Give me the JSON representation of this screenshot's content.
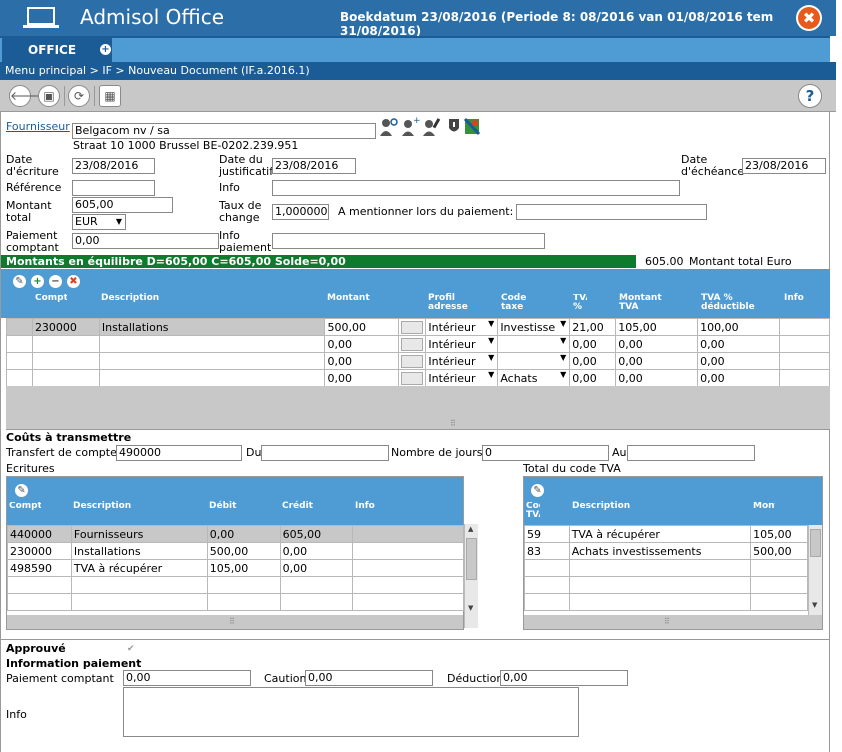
{
  "window": {
    "app_title": "Admisol Office",
    "book_date": "Boekdatum 23/08/2016 (Periode 8: 08/2016 van 01/08/2016 tem 31/08/2016)",
    "close_glyph": "✖"
  },
  "tabs": [
    {
      "label": "OFFICE"
    }
  ],
  "tab_add_glyph": "+",
  "breadcrumb": "Menu principal > IF > Nouveau Document (IF.a.2016.1)",
  "toolbar": {
    "help_glyph": "?",
    "back_glyph": "🡐",
    "save_glyph": "▣",
    "refresh_glyph": "⟳",
    "calendar_glyph": "▦"
  },
  "form": {
    "supplier_label": "Fournisseur",
    "supplier_value": "Belgacom nv / sa",
    "supplier_address": "Straat 10 1000 Brussel BE-0202.239.951",
    "entry_date_label": "Date d'écriture",
    "entry_date": "23/08/2016",
    "doc_date_label": "Date du justificatif",
    "doc_date": "23/08/2016",
    "due_date_label": "Date d'échéance",
    "due_date": "23/08/2016",
    "reference_label": "Référence",
    "reference": "",
    "info_label": "Info",
    "info": "",
    "total_label": "Montant total",
    "total": "605,00",
    "currency": "EUR",
    "rate_label": "Taux de change",
    "rate": "1,000000",
    "mention_label": "A mentionner lors du paiement:",
    "mention": "",
    "cash_label": "Paiement comptant",
    "cash": "0,00",
    "pay_info_label": "Info paiement",
    "pay_info": ""
  },
  "balance": {
    "text": "Montants en équilibre D=605,00 C=605,00 Solde=0,00",
    "total_euro_value": "605.00",
    "total_euro_label": "Montant total Euro"
  },
  "lines_grid": {
    "headers": [
      "Compte",
      "Description",
      "Montant",
      "Profil adresse",
      "Code taxe",
      "TVA %",
      "Montant TVA",
      "TVA % déductible",
      "Info"
    ],
    "rows": [
      [
        "230000",
        "Installations",
        "500,00",
        "",
        "Intérieur",
        "Investisse",
        "21,00",
        "105,00",
        "100,00",
        ""
      ],
      [
        "",
        "",
        "0,00",
        "",
        "Intérieur",
        "",
        "0,00",
        "0,00",
        "0,00",
        ""
      ],
      [
        "",
        "",
        "0,00",
        "",
        "Intérieur",
        "",
        "0,00",
        "0,00",
        "0,00",
        ""
      ],
      [
        "",
        "",
        "0,00",
        "",
        "Intérieur",
        "Achats",
        "0,00",
        "0,00",
        "0,00",
        ""
      ]
    ]
  },
  "transfer": {
    "title": "Coûts à transmettre",
    "account_label": "Transfert de compte",
    "account": "490000",
    "from_label": "Du",
    "from": "",
    "days_label": "Nombre de jours",
    "days": "0",
    "to_label": "Au",
    "to": ""
  },
  "entries": {
    "title": "Ecritures",
    "headers": [
      "Compte",
      "Description",
      "Débit",
      "Crédit",
      "Info"
    ],
    "rows": [
      [
        "440000",
        "Fournisseurs",
        "0,00",
        "605,00",
        ""
      ],
      [
        "230000",
        "Installations",
        "500,00",
        "0,00",
        ""
      ],
      [
        "498590",
        "TVA à récupérer",
        "105,00",
        "0,00",
        ""
      ]
    ]
  },
  "vat_totals": {
    "title": "Total du code TVA",
    "headers": [
      "Code TVA",
      "Description",
      "Montant"
    ],
    "rows": [
      [
        "59",
        "TVA à récupérer",
        "105,00"
      ],
      [
        "83",
        "Achats investissements",
        "500,00"
      ]
    ]
  },
  "payment": {
    "approved_label": "Approuvé",
    "approved_check": "✔",
    "info_title": "Information paiement",
    "cash_label": "Paiement comptant",
    "cash": "0,00",
    "deposit_label": "Caution",
    "deposit": "0,00",
    "deduction_label": "Déduction",
    "deduction": "0,00",
    "info_label": "Info",
    "info": ""
  },
  "colors": {
    "titlebar": "#2c6fa8",
    "tab_active": "#1b5c96",
    "grid_header": "#4f9bd4",
    "balance_ok": "#0e7a2c",
    "close": "#e85a1c"
  }
}
